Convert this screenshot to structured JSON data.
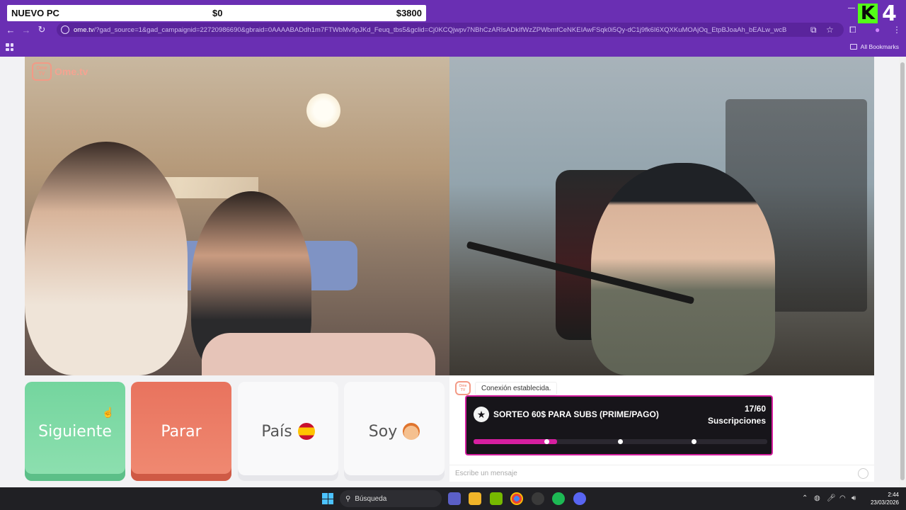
{
  "overlay": {
    "goal_label": "NUEVO PC",
    "current_amount": "$0",
    "target_amount": "$3800",
    "channel_number": "4",
    "channel_logo": "K"
  },
  "browser": {
    "url_host": "ome.tv",
    "url_path": "/?gad_source=1&gad_campaignid=22720986690&gbraid=0AAAABADdh1m7FTWbMv9pJKd_Feuq_tbs5&gclid=Cj0KCQjwpv7NBhCzARIsADkIfWzZPWbmfCeNKEIAwFSqk0i5Qy-dC1j9fk6I6XQXKuMOAjOq_EtpBJoaAh_bEALw_wcB",
    "bookmarks_label": "All Bookmarks"
  },
  "page": {
    "logo_text": "Ome.tv",
    "logo_badge": "Ome TV",
    "buttons": {
      "next": "Siguiente",
      "stop": "Parar",
      "country": "País",
      "gender": "Soy"
    },
    "chat": {
      "system_message": "Conexión establecida.",
      "input_placeholder": "Escribe un mensaje"
    }
  },
  "raffle": {
    "title": "SORTEO 60$ PARA SUBS (PRIME/PAGO)",
    "count": "17/60",
    "count_label": "Suscripciones",
    "progress": 0.2833,
    "accent_color": "#d61fa0"
  },
  "taskbar": {
    "search_label": "Búsqueda",
    "time": "2:44",
    "date": "23/03/2026"
  }
}
